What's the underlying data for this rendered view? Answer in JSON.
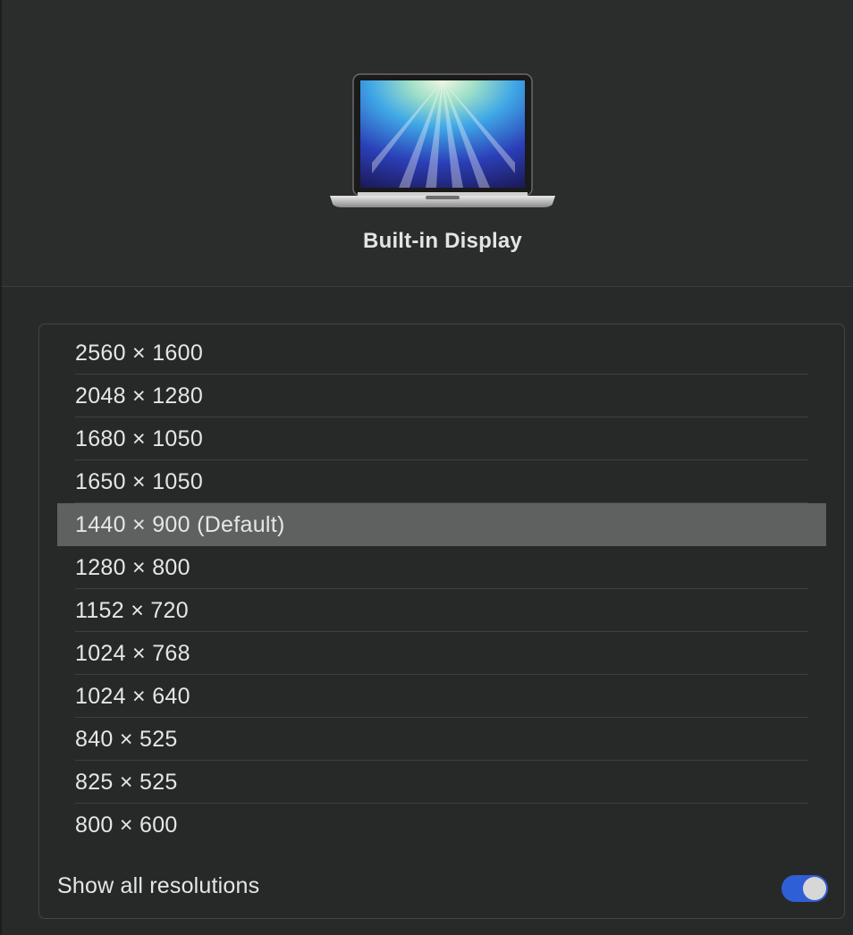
{
  "header": {
    "display_name": "Built-in Display"
  },
  "resolutions": [
    {
      "label": "2560 × 1600",
      "selected": false
    },
    {
      "label": "2048 × 1280",
      "selected": false
    },
    {
      "label": "1680 × 1050",
      "selected": false
    },
    {
      "label": "1650 × 1050",
      "selected": false
    },
    {
      "label": "1440 × 900 (Default)",
      "selected": true
    },
    {
      "label": "1280 × 800",
      "selected": false
    },
    {
      "label": "1152 × 720",
      "selected": false
    },
    {
      "label": "1024 × 768",
      "selected": false
    },
    {
      "label": "1024 × 640",
      "selected": false
    },
    {
      "label": "840 × 525",
      "selected": false
    },
    {
      "label": "825 × 525",
      "selected": false
    },
    {
      "label": "800 × 600",
      "selected": false
    }
  ],
  "footer": {
    "show_all_label": "Show all resolutions",
    "show_all_enabled": true
  },
  "colors": {
    "accent": "#2f5fd6",
    "selected_row": "#5f6161"
  }
}
